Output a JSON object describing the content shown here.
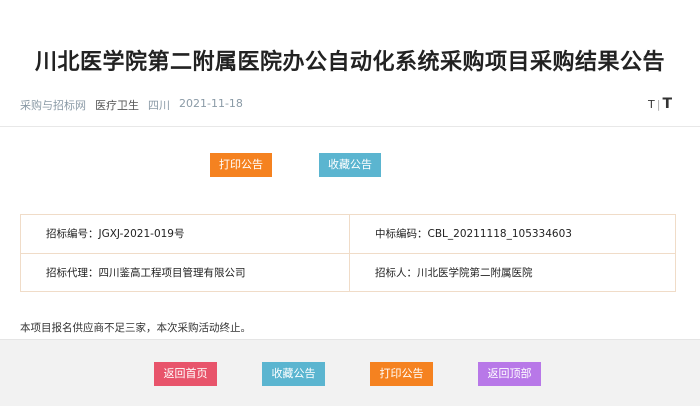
{
  "article": {
    "title": "川北医学院第二附属医院办公自动化系统采购项目采购结果公告",
    "source": "采购与招标网",
    "industry": "医疗卫生",
    "region": "四川",
    "date": "2021-11-18"
  },
  "font_size_toggle": {
    "small": "T",
    "separator": "|",
    "large": "T"
  },
  "actions_top": {
    "print_label": "打印公告",
    "favorite_label": "收藏公告"
  },
  "info_table": {
    "tender_no": "招标编号：JGXJ-2021-019号",
    "bid_code": "中标编码：CBL_20211118_105334603",
    "agent": "招标代理：四川鉴高工程项目管理有限公司",
    "tenderer": "招标人：川北医学院第二附属医院"
  },
  "notice_text": "本项目报名供应商不足三家，本次采购活动终止。",
  "footer_actions": {
    "home_label": "返回首页",
    "favorite_label": "收藏公告",
    "print_label": "打印公告",
    "top_label": "返回顶部"
  },
  "colors": {
    "print": "#f58220",
    "favorite": "#5bb5d0",
    "home": "#e8546b",
    "top": "#b878e8"
  }
}
